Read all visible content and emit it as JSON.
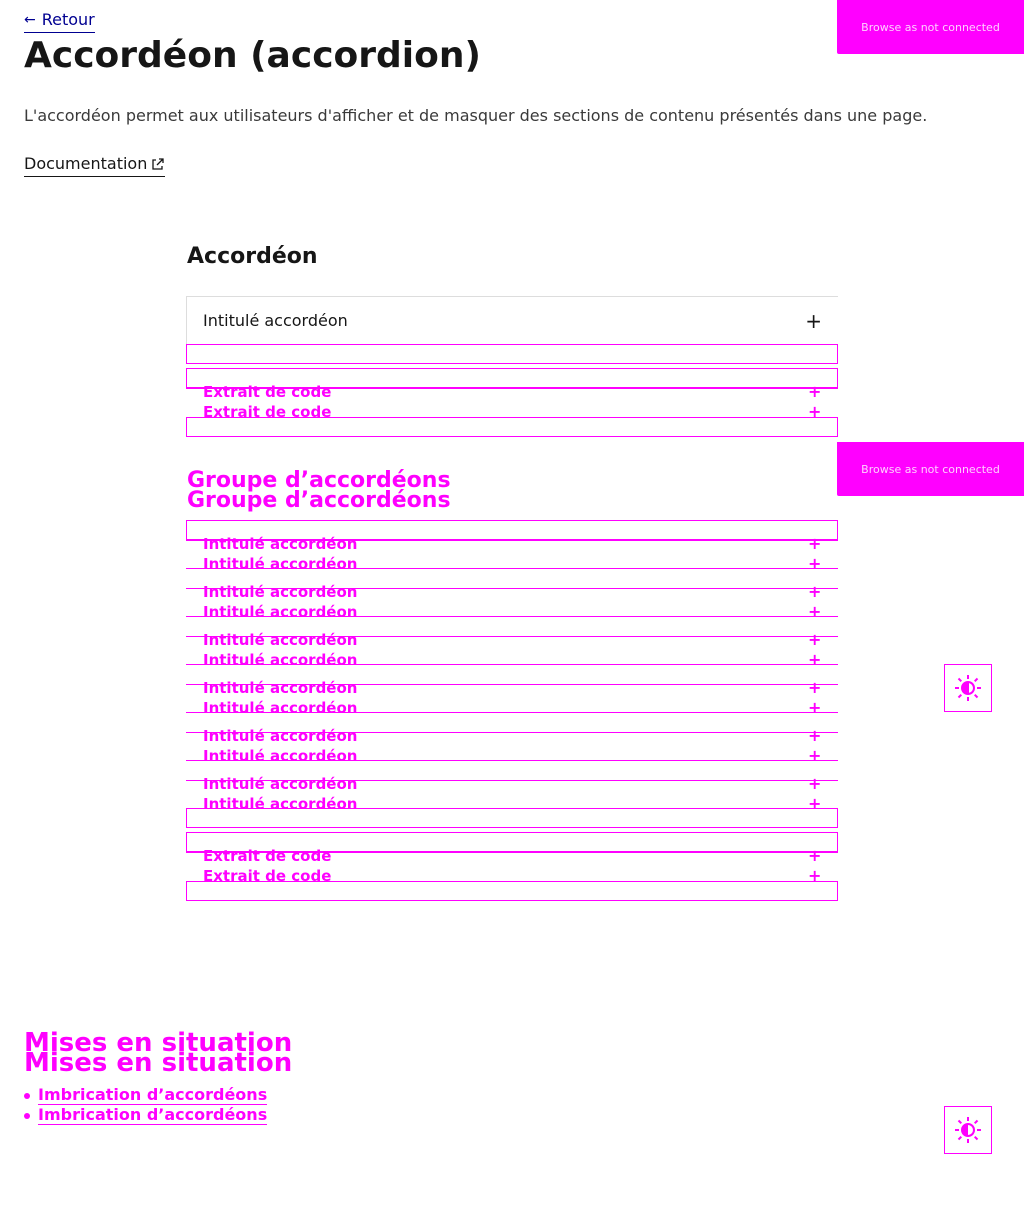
{
  "header": {
    "back_label": "Retour",
    "title": "Accordéon (accordion)",
    "lead": "L'accordéon permet aux utilisateurs d'afficher et de masquer des sections de contenu présentés dans une page.",
    "doc_label": "Documentation"
  },
  "badges": {
    "label": "Browse as not connected"
  },
  "demo": {
    "title": "Accordéon",
    "accordion_label": "Intitulé accordéon",
    "code_label": "Extrait de code",
    "group_title": "Groupe d’accordéons"
  },
  "situations": {
    "title": "Mises en situation",
    "item_label": "Imbrication d’accordéons"
  },
  "colors": {
    "accent": "#000091",
    "debug": "#ff00ff"
  }
}
